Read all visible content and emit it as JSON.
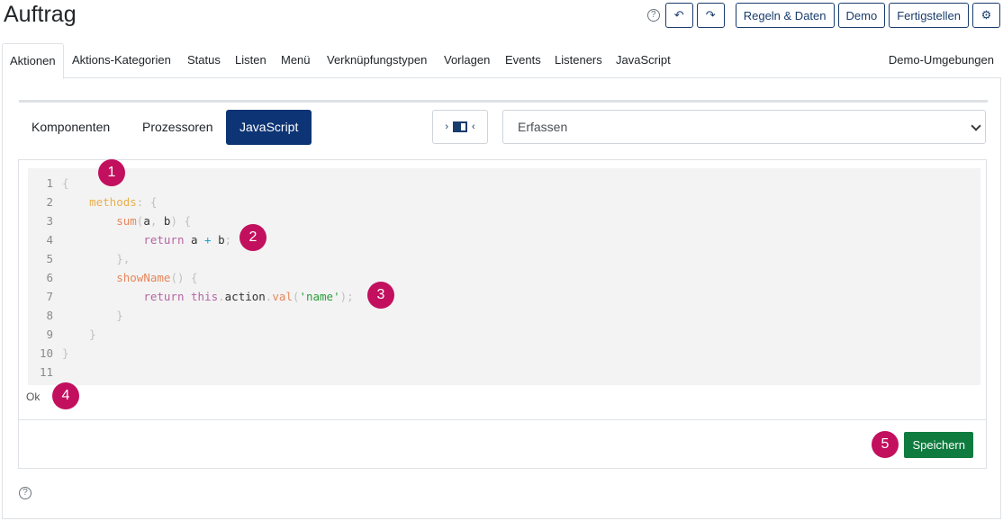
{
  "page": {
    "title": "Auftrag"
  },
  "toolbar": {
    "help_icon": "?",
    "undo_icon": "↶",
    "redo_icon": "↷",
    "rules_label": "Regeln & Daten",
    "demo_label": "Demo",
    "finish_label": "Fertigstellen",
    "settings_icon": "⚙"
  },
  "tabs": [
    {
      "label": "Aktionen"
    },
    {
      "label": "Aktions-Kategorien"
    },
    {
      "label": "Status"
    },
    {
      "label": "Listen"
    },
    {
      "label": "Menü"
    },
    {
      "label": "Verknüpfungstypen"
    },
    {
      "label": "Vorlagen"
    },
    {
      "label": "Events"
    },
    {
      "label": "Listeners"
    },
    {
      "label": "JavaScript"
    },
    {
      "label": "Demo-Umgebungen"
    }
  ],
  "subtabs": [
    {
      "label": "Komponenten"
    },
    {
      "label": "Prozessoren"
    },
    {
      "label": "JavaScript"
    }
  ],
  "panel_toggle": {
    "left_icon": "›",
    "right_icon": "‹"
  },
  "select": {
    "value": "Erfassen"
  },
  "editor": {
    "line_numbers": [
      "1",
      "2",
      "3",
      "4",
      "5",
      "6",
      "7",
      "8",
      "9",
      "10",
      "11"
    ],
    "status": "Ok"
  },
  "save_label": "Speichern",
  "bottom_help_icon": "?",
  "markers": [
    "1",
    "2",
    "3",
    "4",
    "5"
  ],
  "colors": {
    "primary": "#0d3474",
    "save": "#0f7b3e",
    "marker": "#c2105e"
  }
}
